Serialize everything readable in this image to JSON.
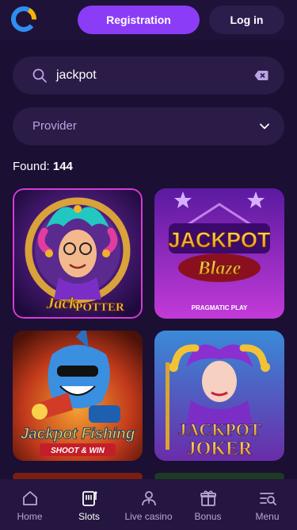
{
  "header": {
    "registration_label": "Registration",
    "login_label": "Log in"
  },
  "search": {
    "value": "jackpot"
  },
  "filter": {
    "provider_label": "Provider"
  },
  "results": {
    "found_label": "Found:",
    "found_count": "144"
  },
  "games": [
    {
      "name": "Jack Potter",
      "logo_text_1": "Jack",
      "logo_text_2": "POTTER"
    },
    {
      "name": "Jackpot Blaze",
      "logo_text_1": "JACKPOT",
      "logo_text_2": "Blaze",
      "provider": "PRAGMATIC PLAY"
    },
    {
      "name": "Jackpot Fishing",
      "logo_text_1": "Jackpot Fishing",
      "logo_text_2": "SHOOT & WIN"
    },
    {
      "name": "Jackpot Joker",
      "logo_text_1": "JACKPOT",
      "logo_text_2": "JOKER"
    }
  ],
  "nav": {
    "items": [
      {
        "label": "Home",
        "icon": "home-icon"
      },
      {
        "label": "Slots",
        "icon": "slots-icon"
      },
      {
        "label": "Live casino",
        "icon": "live-casino-icon"
      },
      {
        "label": "Bonus",
        "icon": "gift-icon"
      },
      {
        "label": "Menu",
        "icon": "menu-search-icon"
      }
    ],
    "active_index": 1
  },
  "colors": {
    "background": "#1b0f33",
    "accent": "#8b3cf7",
    "field": "#2a1b47"
  }
}
